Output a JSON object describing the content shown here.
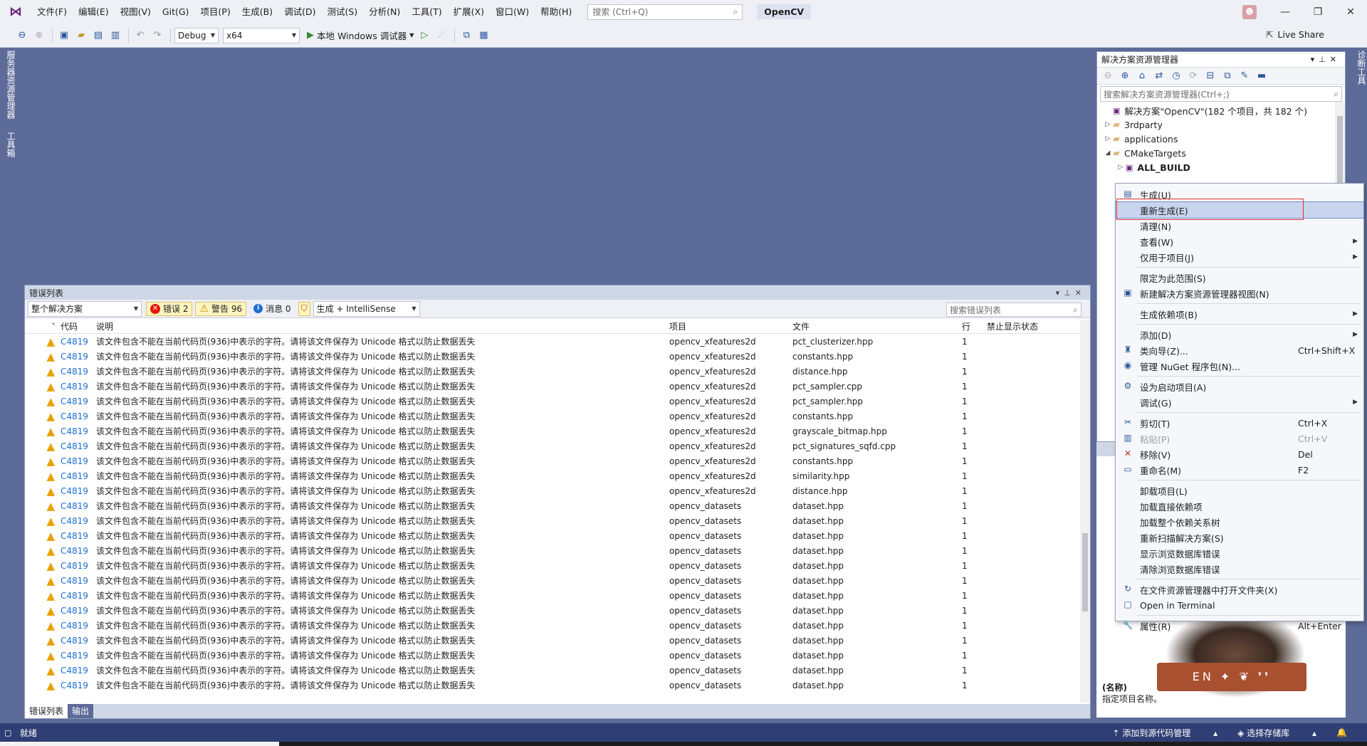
{
  "menubar": {
    "items": [
      "文件(F)",
      "编辑(E)",
      "视图(V)",
      "Git(G)",
      "项目(P)",
      "生成(B)",
      "调试(D)",
      "测试(S)",
      "分析(N)",
      "工具(T)",
      "扩展(X)",
      "窗口(W)",
      "帮助(H)"
    ],
    "search_placeholder": "搜索 (Ctrl+Q)",
    "solution_name": "OpenCV"
  },
  "toolbar": {
    "config": "Debug",
    "platform": "x64",
    "run_label": "本地 Windows 调试器",
    "live_share": "Live Share"
  },
  "left_tabs": [
    "服务器资源管理器",
    "工具箱"
  ],
  "right_tab": "诊断工具",
  "error_list": {
    "title": "错误列表",
    "scope": "整个解决方案",
    "errors": "错误 2",
    "warnings": "警告 96",
    "messages": "消息 0",
    "build_filter": "生成 + IntelliSense",
    "search_placeholder": "搜索错误列表",
    "columns": [
      "代码",
      "说明",
      "项目",
      "文件",
      "行",
      "禁止显示状态"
    ],
    "rows": [
      {
        "code": "C4819",
        "desc": "该文件包含不能在当前代码页(936)中表示的字符。请将该文件保存为 Unicode 格式以防止数据丢失",
        "project": "opencv_xfeatures2d",
        "file": "pct_clusterizer.hpp",
        "line": "1"
      },
      {
        "code": "C4819",
        "desc": "该文件包含不能在当前代码页(936)中表示的字符。请将该文件保存为 Unicode 格式以防止数据丢失",
        "project": "opencv_xfeatures2d",
        "file": "constants.hpp",
        "line": "1"
      },
      {
        "code": "C4819",
        "desc": "该文件包含不能在当前代码页(936)中表示的字符。请将该文件保存为 Unicode 格式以防止数据丢失",
        "project": "opencv_xfeatures2d",
        "file": "distance.hpp",
        "line": "1"
      },
      {
        "code": "C4819",
        "desc": "该文件包含不能在当前代码页(936)中表示的字符。请将该文件保存为 Unicode 格式以防止数据丢失",
        "project": "opencv_xfeatures2d",
        "file": "pct_sampler.cpp",
        "line": "1"
      },
      {
        "code": "C4819",
        "desc": "该文件包含不能在当前代码页(936)中表示的字符。请将该文件保存为 Unicode 格式以防止数据丢失",
        "project": "opencv_xfeatures2d",
        "file": "pct_sampler.hpp",
        "line": "1"
      },
      {
        "code": "C4819",
        "desc": "该文件包含不能在当前代码页(936)中表示的字符。请将该文件保存为 Unicode 格式以防止数据丢失",
        "project": "opencv_xfeatures2d",
        "file": "constants.hpp",
        "line": "1"
      },
      {
        "code": "C4819",
        "desc": "该文件包含不能在当前代码页(936)中表示的字符。请将该文件保存为 Unicode 格式以防止数据丢失",
        "project": "opencv_xfeatures2d",
        "file": "grayscale_bitmap.hpp",
        "line": "1"
      },
      {
        "code": "C4819",
        "desc": "该文件包含不能在当前代码页(936)中表示的字符。请将该文件保存为 Unicode 格式以防止数据丢失",
        "project": "opencv_xfeatures2d",
        "file": "pct_signatures_sqfd.cpp",
        "line": "1"
      },
      {
        "code": "C4819",
        "desc": "该文件包含不能在当前代码页(936)中表示的字符。请将该文件保存为 Unicode 格式以防止数据丢失",
        "project": "opencv_xfeatures2d",
        "file": "constants.hpp",
        "line": "1"
      },
      {
        "code": "C4819",
        "desc": "该文件包含不能在当前代码页(936)中表示的字符。请将该文件保存为 Unicode 格式以防止数据丢失",
        "project": "opencv_xfeatures2d",
        "file": "similarity.hpp",
        "line": "1"
      },
      {
        "code": "C4819",
        "desc": "该文件包含不能在当前代码页(936)中表示的字符。请将该文件保存为 Unicode 格式以防止数据丢失",
        "project": "opencv_xfeatures2d",
        "file": "distance.hpp",
        "line": "1"
      },
      {
        "code": "C4819",
        "desc": "该文件包含不能在当前代码页(936)中表示的字符。请将该文件保存为 Unicode 格式以防止数据丢失",
        "project": "opencv_datasets",
        "file": "dataset.hpp",
        "line": "1"
      },
      {
        "code": "C4819",
        "desc": "该文件包含不能在当前代码页(936)中表示的字符。请将该文件保存为 Unicode 格式以防止数据丢失",
        "project": "opencv_datasets",
        "file": "dataset.hpp",
        "line": "1"
      },
      {
        "code": "C4819",
        "desc": "该文件包含不能在当前代码页(936)中表示的字符。请将该文件保存为 Unicode 格式以防止数据丢失",
        "project": "opencv_datasets",
        "file": "dataset.hpp",
        "line": "1"
      },
      {
        "code": "C4819",
        "desc": "该文件包含不能在当前代码页(936)中表示的字符。请将该文件保存为 Unicode 格式以防止数据丢失",
        "project": "opencv_datasets",
        "file": "dataset.hpp",
        "line": "1"
      },
      {
        "code": "C4819",
        "desc": "该文件包含不能在当前代码页(936)中表示的字符。请将该文件保存为 Unicode 格式以防止数据丢失",
        "project": "opencv_datasets",
        "file": "dataset.hpp",
        "line": "1"
      },
      {
        "code": "C4819",
        "desc": "该文件包含不能在当前代码页(936)中表示的字符。请将该文件保存为 Unicode 格式以防止数据丢失",
        "project": "opencv_datasets",
        "file": "dataset.hpp",
        "line": "1"
      },
      {
        "code": "C4819",
        "desc": "该文件包含不能在当前代码页(936)中表示的字符。请将该文件保存为 Unicode 格式以防止数据丢失",
        "project": "opencv_datasets",
        "file": "dataset.hpp",
        "line": "1"
      },
      {
        "code": "C4819",
        "desc": "该文件包含不能在当前代码页(936)中表示的字符。请将该文件保存为 Unicode 格式以防止数据丢失",
        "project": "opencv_datasets",
        "file": "dataset.hpp",
        "line": "1"
      },
      {
        "code": "C4819",
        "desc": "该文件包含不能在当前代码页(936)中表示的字符。请将该文件保存为 Unicode 格式以防止数据丢失",
        "project": "opencv_datasets",
        "file": "dataset.hpp",
        "line": "1"
      },
      {
        "code": "C4819",
        "desc": "该文件包含不能在当前代码页(936)中表示的字符。请将该文件保存为 Unicode 格式以防止数据丢失",
        "project": "opencv_datasets",
        "file": "dataset.hpp",
        "line": "1"
      },
      {
        "code": "C4819",
        "desc": "该文件包含不能在当前代码页(936)中表示的字符。请将该文件保存为 Unicode 格式以防止数据丢失",
        "project": "opencv_datasets",
        "file": "dataset.hpp",
        "line": "1"
      },
      {
        "code": "C4819",
        "desc": "该文件包含不能在当前代码页(936)中表示的字符。请将该文件保存为 Unicode 格式以防止数据丢失",
        "project": "opencv_datasets",
        "file": "dataset.hpp",
        "line": "1"
      },
      {
        "code": "C4819",
        "desc": "该文件包含不能在当前代码页(936)中表示的字符。请将该文件保存为 Unicode 格式以防止数据丢失",
        "project": "opencv_datasets",
        "file": "dataset.hpp",
        "line": "1"
      }
    ],
    "tabs": [
      "错误列表",
      "输出"
    ]
  },
  "solution_explorer": {
    "title": "解决方案资源管理器",
    "search_placeholder": "搜索解决方案资源管理器(Ctrl+;)",
    "tree": [
      {
        "label": "解决方案\"OpenCV\"(182 个项目，共 182 个)",
        "kind": "solution"
      },
      {
        "label": "3rdparty",
        "kind": "folder"
      },
      {
        "label": "applications",
        "kind": "folder"
      },
      {
        "label": "CMakeTargets",
        "kind": "folder-open"
      },
      {
        "label": "ALL_BUILD",
        "kind": "project"
      }
    ]
  },
  "properties": {
    "name_label": "(名称)",
    "name_desc": "指定项目名称。",
    "banner_text": "EN ✦ ❦ ❜❜"
  },
  "context_menu": {
    "items": [
      {
        "label": "生成(U)",
        "icon": "build-icon"
      },
      {
        "label": "重新生成(E)",
        "highlighted": true
      },
      {
        "label": "清理(N)"
      },
      {
        "label": "查看(W)",
        "submenu": true
      },
      {
        "label": "仅用于项目(J)",
        "submenu": true
      },
      {
        "sep": true
      },
      {
        "label": "限定为此范围(S)"
      },
      {
        "label": "新建解决方案资源管理器视图(N)",
        "icon": "new-view-icon"
      },
      {
        "sep": true
      },
      {
        "label": "生成依赖项(B)",
        "submenu": true
      },
      {
        "sep": true
      },
      {
        "label": "添加(D)",
        "submenu": true
      },
      {
        "label": "类向导(Z)...",
        "icon": "class-wizard-icon",
        "shortcut": "Ctrl+Shift+X"
      },
      {
        "label": "管理 NuGet 程序包(N)...",
        "icon": "nuget-icon"
      },
      {
        "sep": true
      },
      {
        "label": "设为启动项目(A)",
        "icon": "gear-icon"
      },
      {
        "label": "调试(G)",
        "submenu": true
      },
      {
        "sep": true
      },
      {
        "label": "剪切(T)",
        "icon": "cut-icon",
        "shortcut": "Ctrl+X"
      },
      {
        "label": "粘贴(P)",
        "icon": "paste-icon",
        "shortcut": "Ctrl+V",
        "disabled": true
      },
      {
        "label": "移除(V)",
        "icon": "remove-icon",
        "shortcut": "Del"
      },
      {
        "label": "重命名(M)",
        "icon": "rename-icon",
        "shortcut": "F2"
      },
      {
        "sep": true
      },
      {
        "label": "卸载项目(L)"
      },
      {
        "label": "加载直接依赖项"
      },
      {
        "label": "加载整个依赖关系树"
      },
      {
        "label": "重新扫描解决方案(S)"
      },
      {
        "label": "显示浏览数据库错误"
      },
      {
        "label": "清除浏览数据库错误"
      },
      {
        "sep": true
      },
      {
        "label": "在文件资源管理器中打开文件夹(X)",
        "icon": "refresh-icon"
      },
      {
        "label": "Open in Terminal",
        "icon": "terminal-icon"
      },
      {
        "sep": true
      },
      {
        "label": "属性(R)",
        "icon": "wrench-icon",
        "shortcut": "Alt+Enter"
      }
    ]
  },
  "statusbar": {
    "ready": "就绪",
    "source_control": "添加到源代码管理",
    "repo": "选择存储库"
  }
}
